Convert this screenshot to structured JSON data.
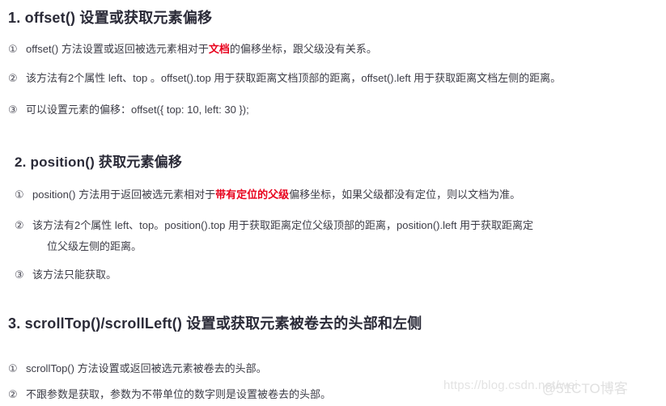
{
  "document": {
    "background_color": "#ffffff",
    "text_color": "#3c3c46",
    "heading_color": "#2b2b38",
    "highlight_color": "#e8001c",
    "watermark_color": "#e3e3e3"
  },
  "sections": [
    {
      "id": "offset",
      "heading_number": "1.",
      "heading_code": "offset()",
      "heading_text": "设置或获取元素偏移",
      "items": [
        {
          "marker": "①",
          "text_before": "offset() 方法设置或返回被选元素相对于",
          "highlight": "文档",
          "text_after": "的偏移坐标，跟父级没有关系。"
        },
        {
          "marker": "②",
          "text_before": "该方法有2个属性 left、top 。offset().top 用于获取距离文档顶部的距离，offset().left 用于获取距离文档左侧的距离。",
          "highlight": "",
          "text_after": ""
        },
        {
          "marker": "③",
          "text_before": "可以设置元素的偏移：offset({ top: 10, left: 30 });",
          "highlight": "",
          "text_after": ""
        }
      ]
    },
    {
      "id": "position",
      "heading_number": "2.",
      "heading_code": "position()",
      "heading_text": "获取元素偏移",
      "items": [
        {
          "marker": "①",
          "text_before": "position() 方法用于返回被选元素相对于",
          "highlight": "带有定位的父级",
          "text_after": "偏移坐标，如果父级都没有定位，则以文档为准。"
        },
        {
          "marker": "②",
          "text_before": "该方法有2个属性 left、top。position().top 用于获取距离定位父级顶部的距离，position().left 用于获取距离定",
          "highlight": "",
          "text_after": "",
          "wrapped_line": "位父级左侧的距离。"
        },
        {
          "marker": "③",
          "text_before": "该方法只能获取。",
          "highlight": "",
          "text_after": ""
        }
      ]
    },
    {
      "id": "scrolltop-scrollleft",
      "heading_number": "3.",
      "heading_code": "scrollTop()/scrollLeft()",
      "heading_text": "设置或获取元素被卷去的头部和左侧",
      "items": [
        {
          "marker": "①",
          "text_before": "scrollTop() 方法设置或返回被选元素被卷去的头部。",
          "highlight": "",
          "text_after": ""
        },
        {
          "marker": "②",
          "text_before": "不跟参数是获取，参数为不带单位的数字则是设置被卷去的头部。",
          "highlight": "",
          "text_after": ""
        }
      ]
    }
  ],
  "watermark": {
    "url_text": "https://blog.csdn.net/wei",
    "brand_text": "@51CTO博客"
  }
}
